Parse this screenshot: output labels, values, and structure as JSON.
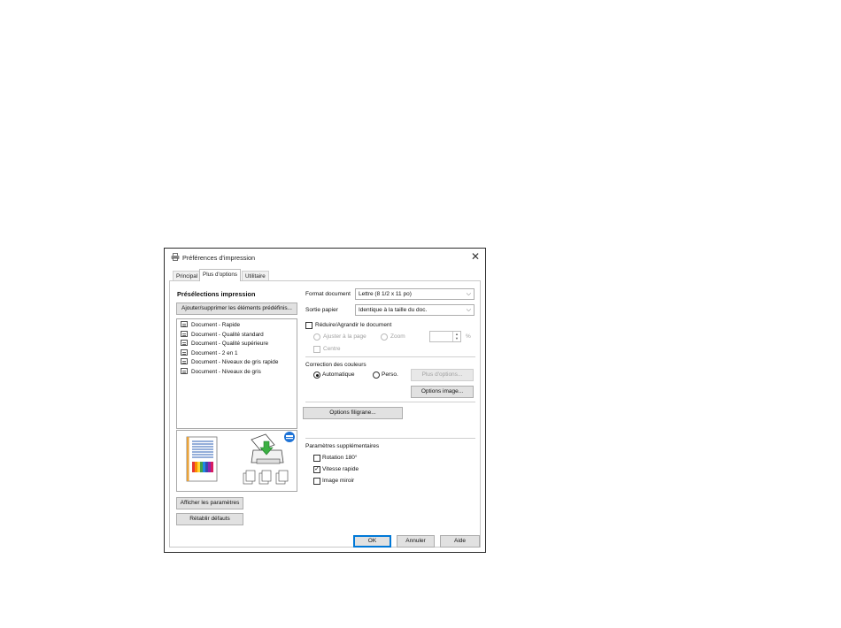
{
  "window": {
    "title": "Préférences d'impression",
    "close_glyph": "✕"
  },
  "tabs": [
    {
      "label": "Principal",
      "active": false
    },
    {
      "label": "Plus d'options",
      "active": true
    },
    {
      "label": "Utilitaire",
      "active": false
    }
  ],
  "presets": {
    "heading": "Présélections impression",
    "add_remove_label": "Ajouter/supprimer les éléments prédéfinis...",
    "items": [
      "Document - Rapide",
      "Document - Qualité standard",
      "Document - Qualité supérieure",
      "Document - 2 en 1",
      "Document - Niveaux de gris rapide",
      "Document - Niveaux de gris"
    ]
  },
  "left_buttons": {
    "show_settings": "Afficher les paramètres",
    "restore_defaults": "Rétablir défauts"
  },
  "document_size": {
    "label": "Format document",
    "value": "Lettre (8 1/2 x 11 po)"
  },
  "output_paper": {
    "label": "Sortie papier",
    "value": "Identique à la taille du doc."
  },
  "reduce_enlarge": {
    "label": "Réduire/Agrandir le document",
    "checked": false,
    "fit_to_page": "Ajuster à la page",
    "zoom": "Zoom",
    "zoom_value": "",
    "percent": "%",
    "center": "Centre"
  },
  "color_correction": {
    "label": "Correction des couleurs",
    "automatic": "Automatique",
    "custom": "Perso.",
    "selected": "automatic",
    "more_options": "Plus d'options...",
    "image_options": "Options image..."
  },
  "watermark_button": "Options filigrane...",
  "extra_settings": {
    "label": "Paramètres supplémentaires",
    "rotation": {
      "label": "Rotation 180°",
      "checked": false
    },
    "high_speed": {
      "label": "Vitesse rapide",
      "checked": true
    },
    "mirror": {
      "label": "Image miroir",
      "checked": false
    }
  },
  "footer": {
    "ok": "OK",
    "cancel": "Annuler",
    "help": "Aide"
  },
  "colors": {
    "accent": "#0078d7",
    "arrow_green": "#3cb043",
    "badge_blue": "#1e73d6",
    "page_orange": "#e8a23a"
  },
  "icons": {
    "title": "printer-icon",
    "badge": "info-badge-icon",
    "arrow": "down-arrow-icon"
  }
}
